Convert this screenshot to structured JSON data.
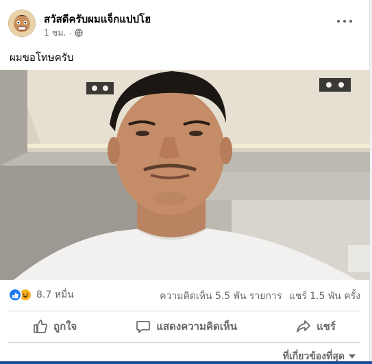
{
  "post": {
    "author": "สวัสดีครับผมแจ็กแปปโฮ",
    "time": "1 ชม.",
    "separator": "·",
    "privacy_icon": "globe-icon",
    "caption": "ผมขอโทษครับ"
  },
  "video": {
    "mute_icon": "speaker-muted-icon"
  },
  "stats": {
    "reactions": [
      "like-icon",
      "haha-icon"
    ],
    "reaction_count": "8.7 หมื่น",
    "comments": "ความคิดเห็น 5.5 พัน รายการ",
    "shares": "แชร์ 1.5 พัน ครั้ง"
  },
  "actions": {
    "like_label": "ถูกใจ",
    "comment_label": "แสดงความคิดเห็น",
    "share_label": "แชร์"
  },
  "comments_sort": {
    "label": "ที่เกี่ยวข้องที่สุด"
  },
  "colors": {
    "accent": "#1877f2",
    "secondary_text": "#65676b",
    "divider": "#ced0d4"
  }
}
